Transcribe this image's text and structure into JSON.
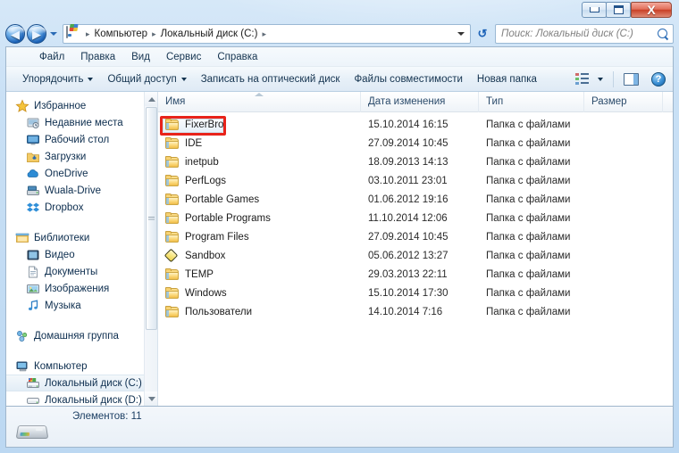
{
  "window": {
    "minimize_label": "Minimize",
    "maximize_label": "Maximize",
    "close_label": "X"
  },
  "address": {
    "back_arrow": "◀",
    "forward_arrow": "▶",
    "crumbs": [
      "Компьютер",
      "Локальный диск (C:)"
    ],
    "separator": "▸",
    "refresh_glyph": "↺"
  },
  "search": {
    "placeholder": "Поиск: Локальный диск (C:)"
  },
  "menubar": {
    "items": [
      {
        "label": "Файл"
      },
      {
        "label": "Правка"
      },
      {
        "label": "Вид"
      },
      {
        "label": "Сервис"
      },
      {
        "label": "Справка"
      }
    ]
  },
  "commandbar": {
    "organize": "Упорядочить",
    "share": "Общий доступ",
    "burn": "Записать на оптический диск",
    "compat": "Файлы совместимости",
    "newfolder": "Новая папка",
    "help_glyph": "?"
  },
  "sidebar": {
    "groups": [
      {
        "header": {
          "label": "Избранное",
          "icon": "star-icon"
        },
        "items": [
          {
            "label": "Недавние места",
            "icon": "recent-places-icon"
          },
          {
            "label": "Рабочий стол",
            "icon": "desktop-icon"
          },
          {
            "label": "Загрузки",
            "icon": "downloads-icon"
          },
          {
            "label": "OneDrive",
            "icon": "onedrive-icon"
          },
          {
            "label": "Wuala-Drive",
            "icon": "wuala-drive-icon"
          },
          {
            "label": "Dropbox",
            "icon": "dropbox-icon"
          }
        ]
      },
      {
        "header": {
          "label": "Библиотеки",
          "icon": "libraries-icon"
        },
        "items": [
          {
            "label": "Видео",
            "icon": "video-icon"
          },
          {
            "label": "Документы",
            "icon": "documents-icon"
          },
          {
            "label": "Изображения",
            "icon": "pictures-icon"
          },
          {
            "label": "Музыка",
            "icon": "music-icon"
          }
        ]
      },
      {
        "header": {
          "label": "Домашняя группа",
          "icon": "homegroup-icon"
        },
        "items": []
      },
      {
        "header": {
          "label": "Компьютер",
          "icon": "computer-icon"
        },
        "items": [
          {
            "label": "Локальный диск (C:)",
            "icon": "local-disk-c-icon",
            "selected": true
          },
          {
            "label": "Локальный диск (D:)",
            "icon": "local-disk-d-icon",
            "selected": false
          }
        ]
      }
    ]
  },
  "filelist": {
    "columns": [
      {
        "label": "Имя",
        "sorted": true
      },
      {
        "label": "Дата изменения",
        "sorted": false
      },
      {
        "label": "Тип",
        "sorted": false
      },
      {
        "label": "Размер",
        "sorted": false
      }
    ],
    "rows": [
      {
        "name": "FixerBro",
        "date": "15.10.2014 16:15",
        "type": "Папка с файлами",
        "size": "",
        "icon": "folder-icon",
        "highlighted": true
      },
      {
        "name": "IDE",
        "date": "27.09.2014 10:45",
        "type": "Папка с файлами",
        "size": "",
        "icon": "folder-icon",
        "highlighted": false
      },
      {
        "name": "inetpub",
        "date": "18.09.2013 14:13",
        "type": "Папка с файлами",
        "size": "",
        "icon": "folder-icon",
        "highlighted": false
      },
      {
        "name": "PerfLogs",
        "date": "03.10.2011 23:01",
        "type": "Папка с файлами",
        "size": "",
        "icon": "folder-icon",
        "highlighted": false
      },
      {
        "name": "Portable Games",
        "date": "01.06.2012 19:16",
        "type": "Папка с файлами",
        "size": "",
        "icon": "folder-icon",
        "highlighted": false
      },
      {
        "name": "Portable Programs",
        "date": "11.10.2014 12:06",
        "type": "Папка с файлами",
        "size": "",
        "icon": "folder-icon",
        "highlighted": false
      },
      {
        "name": "Program Files",
        "date": "27.09.2014 10:45",
        "type": "Папка с файлами",
        "size": "",
        "icon": "folder-icon",
        "highlighted": false
      },
      {
        "name": "Sandbox",
        "date": "05.06.2012 13:27",
        "type": "Папка с файлами",
        "size": "",
        "icon": "sandbox-folder-icon",
        "highlighted": false
      },
      {
        "name": "TEMP",
        "date": "29.03.2013 22:11",
        "type": "Папка с файлами",
        "size": "",
        "icon": "folder-icon",
        "highlighted": false
      },
      {
        "name": "Windows",
        "date": "15.10.2014 17:30",
        "type": "Папка с файлами",
        "size": "",
        "icon": "folder-icon",
        "highlighted": false
      },
      {
        "name": "Пользователи",
        "date": "14.10.2014 7:16",
        "type": "Папка с файлами",
        "size": "",
        "icon": "folder-icon",
        "highlighted": false
      }
    ]
  },
  "statusbar": {
    "text": "Элементов: 11",
    "icon": "local-disk-icon"
  },
  "colors": {
    "highlight_red": "#e8231a",
    "folder_yellow": "#f2c65c",
    "aero_glass": "#c3dcf3",
    "close_button": "#c94127"
  }
}
